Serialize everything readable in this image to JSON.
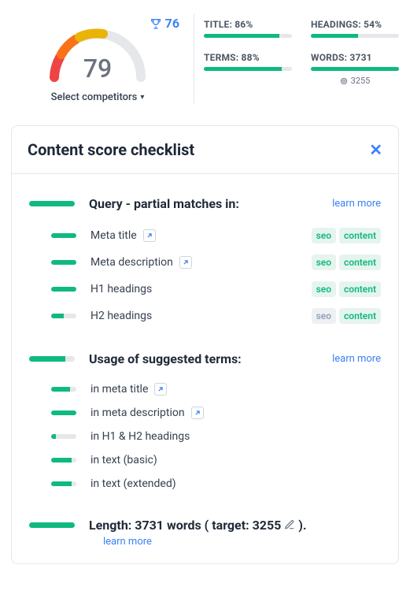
{
  "gauge": {
    "score": "79",
    "trophy": "76",
    "select_label": "Select competitors"
  },
  "metrics": {
    "title": {
      "label": "TITLE: 86%",
      "pct": 86
    },
    "headings": {
      "label": "HEADINGS: 54%",
      "pct": 54
    },
    "terms": {
      "label": "TERMS: 88%",
      "pct": 88
    },
    "words": {
      "label": "WORDS: 3731",
      "pct": 100,
      "target": "3255"
    }
  },
  "card": {
    "title": "Content score checklist"
  },
  "sec_query": {
    "title": "Query - partial matches in:",
    "learn": "learn more",
    "pct": 100,
    "rows": [
      {
        "label": "Meta title",
        "ext": true,
        "pct": 100,
        "seo": true,
        "content": true
      },
      {
        "label": "Meta description",
        "ext": true,
        "pct": 100,
        "seo": true,
        "content": true
      },
      {
        "label": "H1 headings",
        "ext": false,
        "pct": 100,
        "seo": true,
        "content": true
      },
      {
        "label": "H2 headings",
        "ext": false,
        "pct": 50,
        "seo": false,
        "content": true
      }
    ]
  },
  "sec_terms": {
    "title": "Usage of suggested terms:",
    "learn": "learn more",
    "pct": 80,
    "rows": [
      {
        "label": "in meta title",
        "ext": true,
        "pct": 75
      },
      {
        "label": "in meta description",
        "ext": true,
        "pct": 100
      },
      {
        "label": "in H1 & H2 headings",
        "ext": false,
        "pct": 20
      },
      {
        "label": "in text (basic)",
        "ext": false,
        "pct": 80
      },
      {
        "label": "in text (extended)",
        "ext": false,
        "pct": 80
      }
    ]
  },
  "sec_length": {
    "title": "Length: 3731 words ( target: 3255 ",
    "title_suffix": ").",
    "learn": "learn more",
    "pct": 100
  },
  "tag_text": {
    "seo": "seo",
    "content": "content"
  }
}
